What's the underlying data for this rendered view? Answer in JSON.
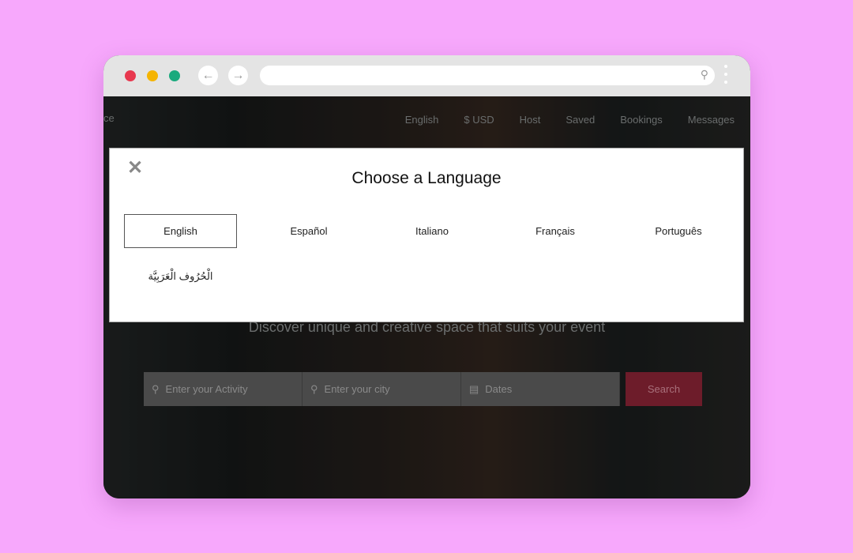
{
  "browser": {
    "url": "",
    "dots": [
      "#e8384f",
      "#f5b400",
      "#1aaa7d"
    ]
  },
  "nav": {
    "brand_fragment": "ce",
    "items": [
      "English",
      "$ USD",
      "Host",
      "Saved",
      "Bookings",
      "Messages"
    ]
  },
  "hero": {
    "tagline": "Discover unique and creative space that suits your event"
  },
  "search": {
    "activity_placeholder": "Enter your Activity",
    "city_placeholder": "Enter your city",
    "dates_placeholder": "Dates",
    "button": "Search"
  },
  "modal": {
    "title": "Choose a Language",
    "close": "✕",
    "selected": "English",
    "languages": [
      "English",
      "Español",
      "Italiano",
      "Français",
      "Português",
      "الْحُرُوف الْعَرَبِيَّة"
    ]
  }
}
